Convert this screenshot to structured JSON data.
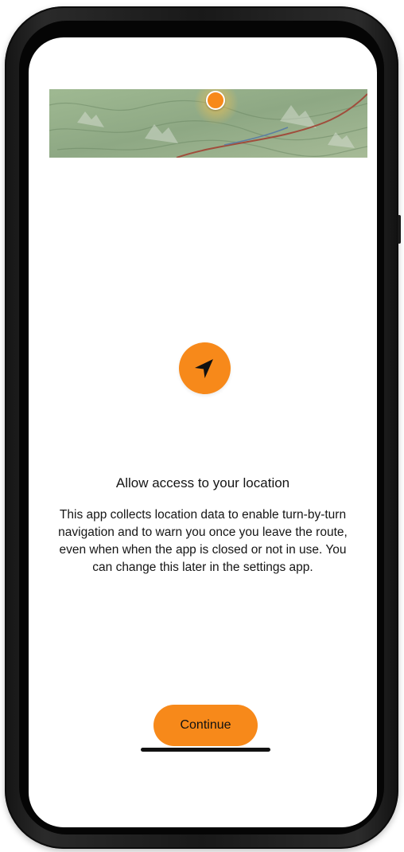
{
  "screen": {
    "title": "Allow access to your location",
    "description": "This app collects location data to enable turn-by-turn navigation and to warn you once you leave the route, even when when the app is closed or not in use. You can change this later in the settings app.",
    "continue_label": "Continue"
  },
  "icons": {
    "location_marker": "location-marker-icon",
    "navigation": "navigation-arrow-icon"
  },
  "colors": {
    "accent": "#f7891a",
    "screen_background": "#ffffff",
    "text": "#151515",
    "phone_frame": "#1c1c1c"
  }
}
